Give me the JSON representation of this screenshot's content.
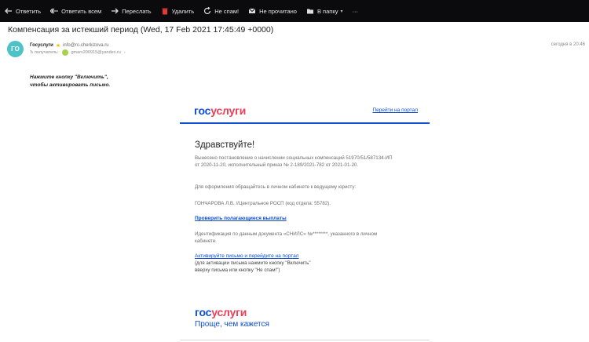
{
  "toolbar": {
    "reply": "Ответить",
    "reply_all": "Ответить всем",
    "forward": "Переслать",
    "delete": "Удалить",
    "not_spam": "Не спам!",
    "unread": "Не прочитано",
    "to_folder": "В папку",
    "more": "···"
  },
  "message": {
    "subject": "Компенсация за истекший период (Wed, 17 Feb 2021 17:45:49 +0000)",
    "avatar": "ГО",
    "from_name": "Госуслуги",
    "from_email": "info@rc-cherkizova.ru",
    "to_label": "Ъ получатель:",
    "to_email": "gmarv200915@yandex.ru",
    "date": "сегодня в 20:46",
    "instruction_line1": "Нажмите кнопку \"Включить\",",
    "instruction_line2": "чтобы активировать письмо."
  },
  "card": {
    "logo_blue": "гос",
    "logo_red": "услуги",
    "portal_link": "Перейти на портал",
    "greeting": "Здравствуйте!",
    "para1_line1": "Вынесено постановление о начислении социальных компенсаций 51970/51/587134-ИП",
    "para1_line2": "от 2020-11-20, исполнительный приказ № 2-189/2021-782 от 2021-01-20.",
    "para2": "Для оформления обращайтесь в личном кабинете к ведущему юристу:",
    "para3": "ГОНЧАРОВА Л.В. //Центральное РОСП (код отдела: 55782).",
    "verify_link": "Проверить полагающиеся выплаты",
    "para4_line1": "Идентификация по данным документа «СНИЛС» №********, указанного в личном",
    "para4_line2": "кабинете.",
    "activate_link": "Активируйте письмо и перейдите на портал",
    "para5_line1": "(для активации письма нажмите кнопку \"Включить\"",
    "para5_line2": "вверху письма или кнопку \"Не спам!\")",
    "slogan": "Проще, чем кажется"
  },
  "colors": {
    "toolbar_bg": "#0b0b0d",
    "brand_blue": "#0d4cd3",
    "brand_red": "#ee3f58",
    "avatar_bg": "#4dc3c8"
  }
}
